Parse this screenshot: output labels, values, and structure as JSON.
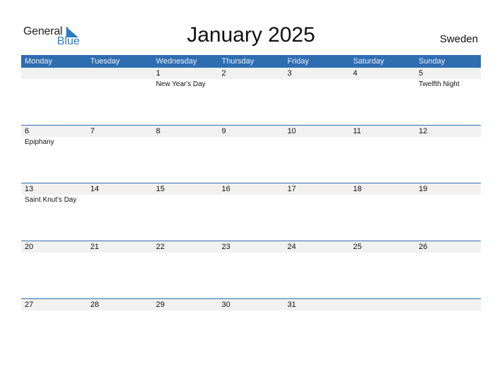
{
  "logo": {
    "general": "General",
    "blue": "Blue"
  },
  "title": "January 2025",
  "country": "Sweden",
  "colors": {
    "header_bg": "#2e6db0",
    "accent": "#2a7bc4",
    "daystrip_bg": "#f1f1f1"
  },
  "weekdays": [
    "Monday",
    "Tuesday",
    "Wednesday",
    "Thursday",
    "Friday",
    "Saturday",
    "Sunday"
  ],
  "weeks": [
    {
      "days": [
        "",
        "",
        "1",
        "2",
        "3",
        "4",
        "5"
      ],
      "events": [
        "",
        "",
        "New Year's Day",
        "",
        "",
        "",
        "Twelfth Night"
      ]
    },
    {
      "days": [
        "6",
        "7",
        "8",
        "9",
        "10",
        "11",
        "12"
      ],
      "events": [
        "Epiphany",
        "",
        "",
        "",
        "",
        "",
        ""
      ]
    },
    {
      "days": [
        "13",
        "14",
        "15",
        "16",
        "17",
        "18",
        "19"
      ],
      "events": [
        "Saint Knut's Day",
        "",
        "",
        "",
        "",
        "",
        ""
      ]
    },
    {
      "days": [
        "20",
        "21",
        "22",
        "23",
        "24",
        "25",
        "26"
      ],
      "events": [
        "",
        "",
        "",
        "",
        "",
        "",
        ""
      ]
    },
    {
      "days": [
        "27",
        "28",
        "29",
        "30",
        "31",
        "",
        ""
      ],
      "events": [
        "",
        "",
        "",
        "",
        "",
        "",
        ""
      ]
    }
  ]
}
